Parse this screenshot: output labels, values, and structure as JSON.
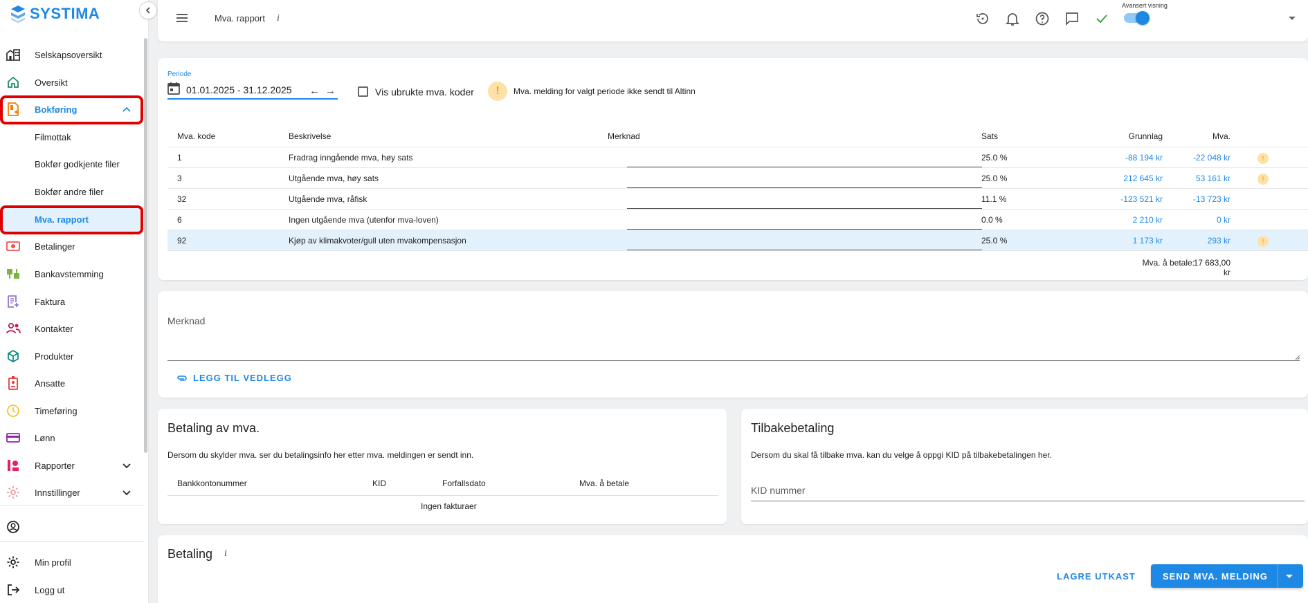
{
  "app": {
    "brand": "SYSTIMA",
    "brand_color": "#1e88e5",
    "alert_color": "#e00000"
  },
  "sidebar": {
    "items": [
      {
        "label": "Selskapsoversikt",
        "icon": "company-icon"
      },
      {
        "label": "Oversikt",
        "icon": "home-icon"
      },
      {
        "label": "Bokføring",
        "icon": "bookkeeping-icon"
      },
      {
        "label": "Filmottak"
      },
      {
        "label": "Bokfør godkjente filer"
      },
      {
        "label": "Bokfør andre filer"
      },
      {
        "label": "Mva. rapport"
      },
      {
        "label": "Betalinger",
        "icon": "payments-icon"
      },
      {
        "label": "Bankavstemming",
        "icon": "bank-reconcile-icon"
      },
      {
        "label": "Faktura",
        "icon": "invoice-icon"
      },
      {
        "label": "Kontakter",
        "icon": "contacts-icon"
      },
      {
        "label": "Produkter",
        "icon": "products-icon"
      },
      {
        "label": "Ansatte",
        "icon": "employees-icon"
      },
      {
        "label": "Timeføring",
        "icon": "clock-icon"
      },
      {
        "label": "Lønn",
        "icon": "salary-icon"
      },
      {
        "label": "Rapporter",
        "icon": "reports-icon"
      },
      {
        "label": "Innstillinger",
        "icon": "settings-icon"
      }
    ],
    "bottom": [
      {
        "label": "Min profil",
        "icon": "gear-icon"
      },
      {
        "label": "Logg ut",
        "icon": "logout-icon"
      }
    ]
  },
  "header": {
    "title": "Mva. rapport",
    "info": "i",
    "advanced_label": "Avansert visning",
    "advanced_on": true
  },
  "period": {
    "label": "Periode",
    "value": "01.01.2025 - 31.12.2025",
    "prev": "←",
    "next": "→",
    "show_unused_label": "Vis ubrukte mva. koder",
    "show_unused_checked": false,
    "warning": "Mva. melding for valgt periode ikke sendt til Altinn",
    "warning_mark": "!"
  },
  "vat_table": {
    "headers": [
      "Mva. kode",
      "Beskrivelse",
      "Merknad",
      "Sats",
      "Grunnlag",
      "Mva."
    ],
    "rows": [
      {
        "code": "1",
        "desc": "Fradrag inngående mva, høy sats",
        "rate": "25.0 %",
        "base": "-88 194 kr",
        "vat": "-22 048 kr",
        "warn": "!"
      },
      {
        "code": "3",
        "desc": "Utgående mva, høy sats",
        "rate": "25.0 %",
        "base": "212 645 kr",
        "vat": "53 161 kr",
        "warn": "!"
      },
      {
        "code": "32",
        "desc": "Utgående mva, råfisk",
        "rate": "11.1 %",
        "base": "-123 521 kr",
        "vat": "-13 723 kr",
        "warn": ""
      },
      {
        "code": "6",
        "desc": "Ingen utgående mva (utenfor mva-loven)",
        "rate": "0.0 %",
        "base": "2 210 kr",
        "vat": "0 kr",
        "warn": ""
      },
      {
        "code": "92",
        "desc": "Kjøp av klimakvoter/gull uten mvakompensasjon",
        "rate": "25.0 %",
        "base": "1 173 kr",
        "vat": "293 kr",
        "warn": "!"
      }
    ],
    "total_label": "Mva. å betale:",
    "total_value": "17 683,00 kr"
  },
  "note": {
    "label": "Merknad",
    "attach_label": "LEGG TIL VEDLEGG"
  },
  "payment_vat": {
    "title": "Betaling av mva.",
    "desc": "Dersom du skylder mva. ser du betalingsinfo her etter mva. meldingen er sendt inn.",
    "headers": [
      "Bankkontonummer",
      "KID",
      "Forfallsdato",
      "Mva. å betale"
    ],
    "empty": "Ingen fakturaer"
  },
  "refund": {
    "title": "Tilbakebetaling",
    "desc": "Dersom du skal få tilbake mva. kan du velge å oppgi KID på tilbakebetalingen her.",
    "kid_placeholder": "KID nummer"
  },
  "payment": {
    "title": "Betaling",
    "info": "i",
    "save_draft": "LAGRE UTKAST",
    "send": "SEND MVA. MELDING"
  }
}
